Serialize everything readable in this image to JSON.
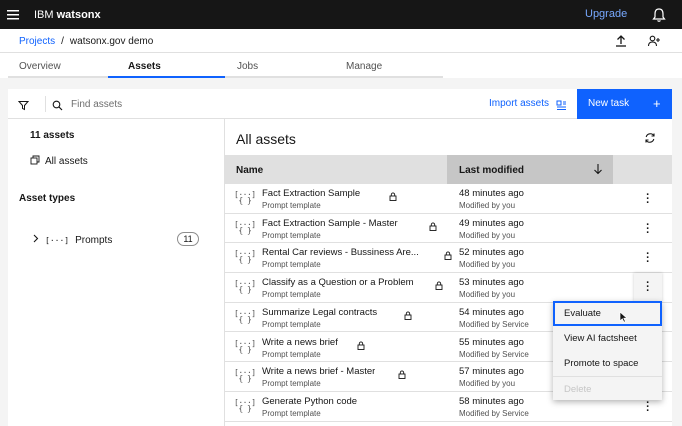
{
  "topbar": {
    "brand_prefix": "IBM",
    "brand_name": "watsonx",
    "upgrade": "Upgrade"
  },
  "breadcrumb": {
    "projects": "Projects",
    "separator": "/",
    "current": "watsonx.gov demo"
  },
  "tabs": [
    {
      "label": "Overview"
    },
    {
      "label": "Assets"
    },
    {
      "label": "Jobs"
    },
    {
      "label": "Manage"
    }
  ],
  "toolbar": {
    "search_placeholder": "Find assets",
    "import_label": "Import assets",
    "new_task_label": "New task",
    "new_task_icon": "+"
  },
  "sidebar": {
    "count": "11 assets",
    "all_assets": "All assets",
    "asset_types": "Asset types",
    "prompts_label": "Prompts",
    "prompts_icon": "[···]",
    "prompts_count": "11"
  },
  "main": {
    "title": "All assets",
    "columns": {
      "name": "Name",
      "modified": "Last modified"
    },
    "rows": [
      {
        "name": "Fact Extraction Sample",
        "type": "Prompt template",
        "time": "48 minutes ago",
        "by": "Modified by you",
        "locked": true
      },
      {
        "name": "Fact Extraction Sample - Master",
        "type": "Prompt template",
        "time": "49 minutes ago",
        "by": "Modified by you",
        "locked": true
      },
      {
        "name": "Rental Car reviews - Bussiness Are...",
        "type": "Prompt template",
        "time": "52 minutes ago",
        "by": "Modified by you",
        "locked": true
      },
      {
        "name": "Classify as a Question or a Problem",
        "type": "Prompt template",
        "time": "53 minutes ago",
        "by": "Modified by you",
        "locked": true
      },
      {
        "name": "Summarize Legal contracts",
        "type": "Prompt template",
        "time": "54 minutes ago",
        "by": "Modified by Service",
        "locked": true
      },
      {
        "name": "Write a news brief",
        "type": "Prompt template",
        "time": "55 minutes ago",
        "by": "Modified by Service",
        "locked": true
      },
      {
        "name": "Write a news brief - Master",
        "type": "Prompt template",
        "time": "57 minutes ago",
        "by": "Modified by you",
        "locked": true
      },
      {
        "name": "Generate Python code",
        "type": "Prompt template",
        "time": "58 minutes ago",
        "by": "Modified by Service",
        "locked": false
      }
    ]
  },
  "overflow_menu": {
    "items": [
      {
        "label": "Evaluate"
      },
      {
        "label": "View AI factsheet"
      },
      {
        "label": "Promote to space"
      },
      {
        "label": "Delete"
      }
    ]
  },
  "colors": {
    "primary": "#0f62fe",
    "topbar": "#161616",
    "upgrade_link": "#78a9ff"
  }
}
